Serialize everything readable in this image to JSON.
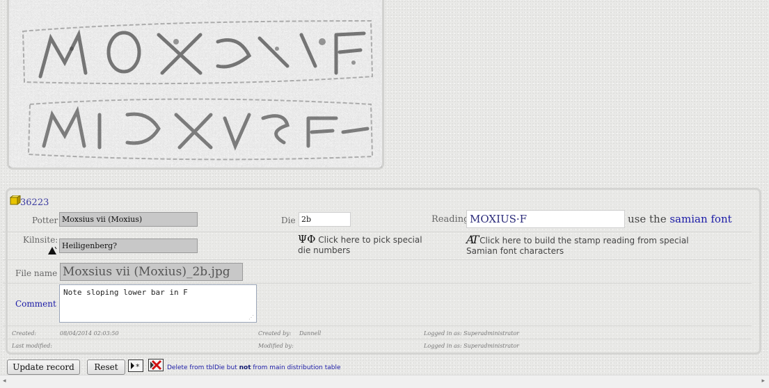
{
  "record": {
    "id": "36223",
    "potter_label": "Potter",
    "potter_value": "Moxsius vii (Moxius)",
    "die_label": "Die",
    "die_value": "2b",
    "reading_label": "Reading",
    "reading_value": "MOXIUS·F",
    "use_the": "use the ",
    "samian_font_link": "samian font",
    "kilnsite_label": "Kilnsite:",
    "kilnsite_value": "Heiligenberg?",
    "die_picker_symbols": "ΨΦ",
    "die_picker_text": " Click here to pick special die numbers",
    "reading_builder_glyph": "AT",
    "reading_builder_text": " Click here to build the stamp reading from special Samian font characters",
    "filename_label": "File name",
    "filename_value": "Moxsius vii (Moxius)_2b.jpg",
    "comment_label": "Comment",
    "comment_value": "Note sloping lower bar in F"
  },
  "meta": {
    "created_label": "Created:",
    "created_value": "08/04/2014 02:03:50",
    "created_by_label": "Created by:",
    "created_by_value": "Dannell",
    "logged_in_1": "Logged in as: Superadministrator",
    "last_modified_label": "Last modified:",
    "modified_by_label": "Modified by:",
    "logged_in_2": "Logged in as: Superadministrator"
  },
  "actions": {
    "update_label": "Update record",
    "reset_label": "Reset",
    "delete_prefix": "Delete from tblDie but ",
    "delete_not": "not",
    "delete_suffix": " from main distribution table"
  },
  "colors": {
    "link": "#1a1aa6",
    "label": "#666666",
    "field_bg": "#c8c8c8"
  },
  "icons": {
    "record": "yellow-box-icon",
    "kiln": "triangle-icon",
    "new": "new-record-icon",
    "delete": "delete-icon"
  }
}
